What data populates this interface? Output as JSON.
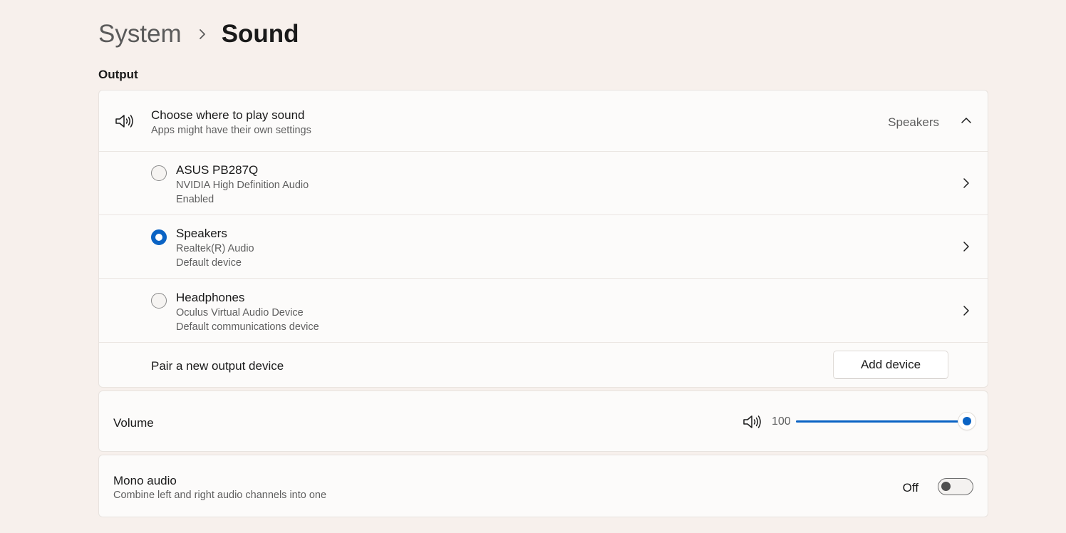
{
  "breadcrumb": {
    "parent": "System",
    "current": "Sound"
  },
  "output": {
    "section_title": "Output",
    "choose": {
      "title": "Choose where to play sound",
      "subtitle": "Apps might have their own settings",
      "selected_value": "Speakers",
      "icon": "speaker-icon",
      "expanded": true
    },
    "devices": [
      {
        "name": "ASUS PB287Q",
        "driver": "NVIDIA High Definition Audio",
        "status": "Enabled",
        "selected": false
      },
      {
        "name": "Speakers",
        "driver": "Realtek(R) Audio",
        "status": "Default device",
        "selected": true
      },
      {
        "name": "Headphones",
        "driver": "Oculus Virtual Audio Device",
        "status": "Default communications device",
        "selected": false
      }
    ],
    "pair": {
      "label": "Pair a new output device",
      "button_label": "Add device"
    }
  },
  "volume": {
    "label": "Volume",
    "value": "100",
    "level": 100,
    "icon": "speaker-icon"
  },
  "mono": {
    "title": "Mono audio",
    "subtitle": "Combine left and right audio channels into one",
    "state_label": "Off",
    "on": false
  },
  "colors": {
    "accent": "#0a63c4",
    "background": "#f7f0ec",
    "card": "#fcfbfa"
  }
}
